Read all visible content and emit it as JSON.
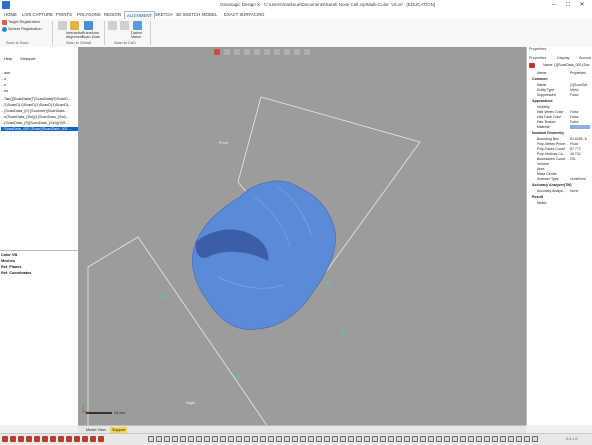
{
  "window": {
    "title": "Geomagic Design X - C:\\Users\\marknue\\Documents\\Sarah Nose Cell.xrp\\Multi-Color. Vd.xrl - [EDUCATION]",
    "minimize": "–",
    "maximize": "□",
    "close": "✕"
  },
  "ribbon_tabs": [
    "HOME",
    "LIVE CAPTURE",
    "POINTS",
    "POLYGONS",
    "REGION",
    "ALIGNMENT",
    "SKETCH",
    "3D SKETCH",
    "MODEL",
    "EXACT SURFACING"
  ],
  "active_tab": "ALIGNMENT",
  "ribbon": {
    "target_registration": "Target Registration",
    "sphere_registration": "Sphere Registration",
    "scan_to_scan": "Scan to Scan",
    "interactive_label": "Interactive Alignment",
    "transform_label": "Transform Scan Data",
    "scan_to_global": "Scan to Global",
    "datum_match": "Datum Match",
    "scan_to_cad": "Scan to CAD"
  },
  "left_panel": {
    "tabs": [
      "Help",
      "Viewport"
    ],
    "tree": [
      "...ase",
      "...s",
      "...n",
      "...ns",
      "...Tan(][ScanData(T)ScanData(3)ScanD...",
      "...2)ScanD(1)ScanD(1)ScanD(1)ScanD(...",
      "...(ScanData_(0) (Scanner)(ScanData...",
      "...n(ScanData_(Sel)(1)ScanData_(Sel)...",
      "...(ScanData_(5)(ScanData_(Sel))(5)S...",
      "...ScanData_000 (Scan)(ScanData_001 ..."
    ],
    "selected_index": 9,
    "display_items": [
      "Color VB",
      "Meshes",
      "Ref. Planes",
      "Ref. Coordinates"
    ]
  },
  "viewport": {
    "plane_label_front": "Front",
    "plane_label_right": "Right",
    "scale_label": "25 mm"
  },
  "right_panel": {
    "title": "Properties",
    "tabs": [
      "Properties",
      "Display",
      "Accura"
    ],
    "columns": [
      "Name",
      "Properties"
    ],
    "header_value": "Name: [1]ScanData_000 (Sca",
    "sections": [
      {
        "name": "Common",
        "rows": [
          [
            "Name",
            "[1]ScanDat"
          ],
          [
            "Entity Type",
            "Mesh"
          ],
          [
            "Suppressed",
            "False"
          ]
        ]
      },
      {
        "name": "Appearance",
        "rows": [
          [
            "Visibility",
            ""
          ],
          [
            "Has Vertex Color",
            "False"
          ],
          [
            "Has Face Color",
            "False"
          ],
          [
            "Has Texture",
            "False"
          ],
          [
            "Material",
            ""
          ]
        ]
      },
      {
        "name": "Nominal Geometry",
        "rows": [
          [
            "Bounding Box",
            "83.8285, 8"
          ],
          [
            "Poly-Vertex Proce...",
            "Float"
          ],
          [
            "Poly-Faces Count",
            "87,773"
          ],
          [
            "Poly-Vertices Co...",
            "46,732"
          ],
          [
            "Boundaries Count",
            "251"
          ],
          [
            "Volume",
            ""
          ],
          [
            "Area",
            ""
          ],
          [
            "Mass Center",
            ""
          ],
          [
            "Scanner Type",
            "Undefined"
          ]
        ]
      },
      {
        "name": "Accuracy Analyzer(TM)",
        "rows": [
          [
            "Accuracy Analys...",
            "None"
          ]
        ]
      },
      {
        "name": "Result",
        "rows": [
          [
            "Matrix",
            ""
          ]
        ]
      }
    ]
  },
  "bottom_tabs": [
    "Model View",
    "Support"
  ],
  "bottom_active": "Support",
  "statusbar": {
    "version": "2.0.1.0"
  },
  "colors": {
    "accent": "#1a5fb4",
    "mesh": "#5b8bd6",
    "viewport": "#9c9c9c",
    "selection": "#0a64c8"
  }
}
